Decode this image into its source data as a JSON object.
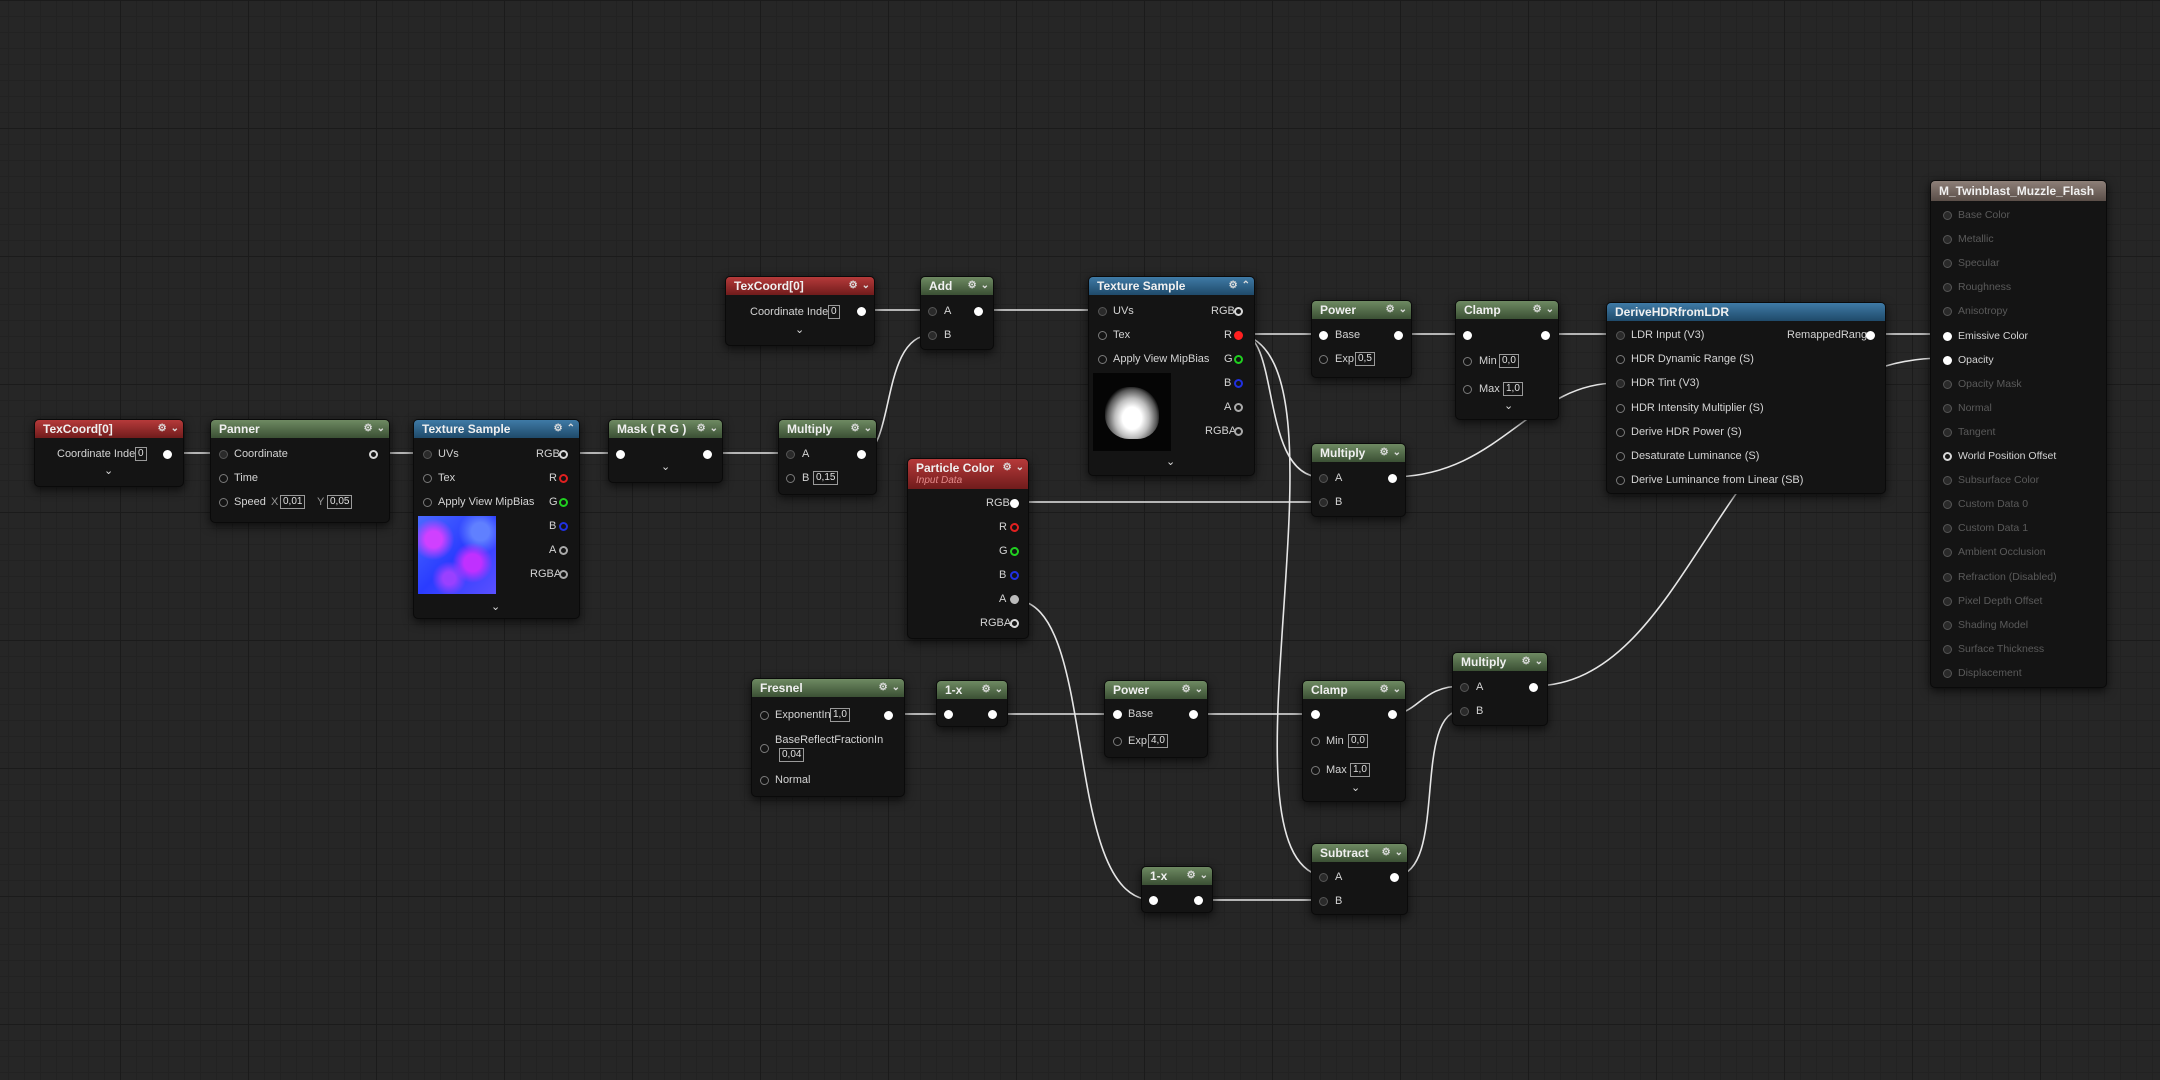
{
  "nodes": {
    "texcoord_a": {
      "title": "TexCoord[0]",
      "coord_label": "Coordinate Index",
      "coord_value": "0"
    },
    "panner": {
      "title": "Panner",
      "coordinate": "Coordinate",
      "time": "Time",
      "speed": "Speed",
      "x_label": "X",
      "x_value": "0,01",
      "y_label": "Y",
      "y_value": "0,05"
    },
    "texsample_a": {
      "title": "Texture Sample",
      "uvs": "UVs",
      "tex": "Tex",
      "mip": "Apply View MipBias",
      "rgb": "RGB",
      "r": "R",
      "g": "G",
      "b": "B",
      "a": "A",
      "rgba": "RGBA"
    },
    "mask": {
      "title": "Mask ( R G )"
    },
    "multiply_a": {
      "title": "Multiply",
      "a": "A",
      "b": "B",
      "b_value": "0,15"
    },
    "texcoord_b": {
      "title": "TexCoord[0]",
      "coord_label": "Coordinate Index",
      "coord_value": "0"
    },
    "add": {
      "title": "Add",
      "a": "A",
      "b": "B"
    },
    "texsample_b": {
      "title": "Texture Sample",
      "uvs": "UVs",
      "tex": "Tex",
      "mip": "Apply View MipBias",
      "rgb": "RGB",
      "r": "R",
      "g": "G",
      "b": "B",
      "a": "A",
      "rgba": "RGBA"
    },
    "particle_color": {
      "title": "Particle Color",
      "subtitle": "Input Data",
      "rgb": "RGB",
      "r": "R",
      "g": "G",
      "b": "B",
      "a": "A",
      "rgba": "RGBA"
    },
    "power_a": {
      "title": "Power",
      "base": "Base",
      "exp": "Exp",
      "exp_value": "0,5"
    },
    "clamp_a": {
      "title": "Clamp",
      "min": "Min",
      "min_value": "0,0",
      "max": "Max",
      "max_value": "1,0"
    },
    "multiply_b": {
      "title": "Multiply",
      "a": "A",
      "b": "B"
    },
    "derive": {
      "title": "DeriveHDRfromLDR",
      "in1": "LDR Input (V3)",
      "in2": "HDR Dynamic Range (S)",
      "in3": "HDR Tint (V3)",
      "in4": "HDR Intensity Multiplier (S)",
      "in5": "Derive HDR Power (S)",
      "in6": "Desaturate Luminance (S)",
      "in7": "Derive Luminance from Linear (SB)",
      "out": "RemappedRange"
    },
    "fresnel": {
      "title": "Fresnel",
      "exponent": "ExponentIn",
      "exponent_value": "1,0",
      "base_reflect": "BaseReflectFractionIn",
      "base_reflect_value": "0,04",
      "normal": "Normal"
    },
    "one_minus_a": {
      "title": "1-x"
    },
    "power_b": {
      "title": "Power",
      "base": "Base",
      "exp": "Exp",
      "exp_value": "4,0"
    },
    "clamp_b": {
      "title": "Clamp",
      "min": "Min",
      "min_value": "0,0",
      "max": "Max",
      "max_value": "1,0"
    },
    "multiply_c": {
      "title": "Multiply",
      "a": "A",
      "b": "B"
    },
    "one_minus_b": {
      "title": "1-x"
    },
    "subtract": {
      "title": "Subtract",
      "a": "A",
      "b": "B"
    }
  },
  "material_output": {
    "title": "M_Twinblast_Muzzle_Flash",
    "inputs": [
      "Base Color",
      "Metallic",
      "Specular",
      "Roughness",
      "Anisotropy",
      "Emissive Color",
      "Opacity",
      "Opacity Mask",
      "Normal",
      "Tangent",
      "World Position Offset",
      "Subsurface Color",
      "Custom Data 0",
      "Custom Data 1",
      "Ambient Occlusion",
      "Refraction (Disabled)",
      "Pixel Depth Offset",
      "Shading Model",
      "Surface Thickness",
      "Displacement"
    ]
  },
  "icons": {
    "collapse": "gear-icon",
    "expand": "chevron-down-icon"
  }
}
